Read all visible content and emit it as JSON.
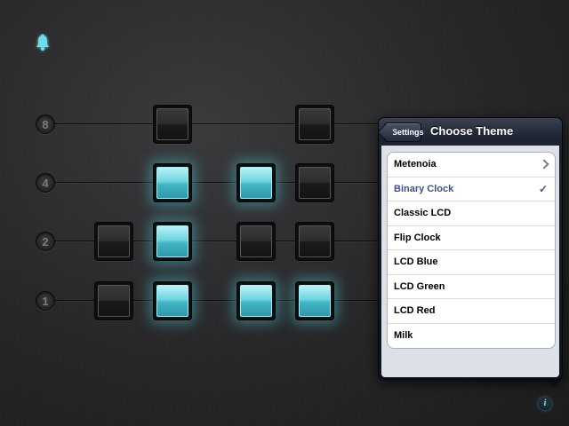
{
  "clock": {
    "rows": [
      {
        "label": "8",
        "bits": [
          null,
          false,
          null,
          false,
          null
        ]
      },
      {
        "label": "4",
        "bits": [
          null,
          true,
          true,
          false,
          null
        ]
      },
      {
        "label": "2",
        "bits": [
          false,
          true,
          false,
          false,
          null
        ]
      },
      {
        "label": "1",
        "bits": [
          false,
          true,
          true,
          true,
          null
        ]
      }
    ]
  },
  "popover": {
    "back_label": "Settings",
    "title": "Choose Theme",
    "themes": [
      {
        "label": "Metenoia",
        "accessory": "chevron",
        "selected": false
      },
      {
        "label": "Binary Clock",
        "accessory": "checkmark",
        "selected": true
      },
      {
        "label": "Classic LCD",
        "accessory": "none",
        "selected": false
      },
      {
        "label": "Flip Clock",
        "accessory": "none",
        "selected": false
      },
      {
        "label": "LCD Blue",
        "accessory": "none",
        "selected": false
      },
      {
        "label": "LCD Green",
        "accessory": "none",
        "selected": false
      },
      {
        "label": "LCD Red",
        "accessory": "none",
        "selected": false
      },
      {
        "label": "Milk",
        "accessory": "none",
        "selected": false
      }
    ]
  },
  "icons": {
    "alarm": "bell-icon",
    "info": "info-icon",
    "info_glyph": "i",
    "check_glyph": "✓"
  },
  "colors": {
    "bit_on": "#5fd0dd",
    "bit_off": "#2c2c2e",
    "selected_text": "#385487",
    "background": "#262628"
  }
}
